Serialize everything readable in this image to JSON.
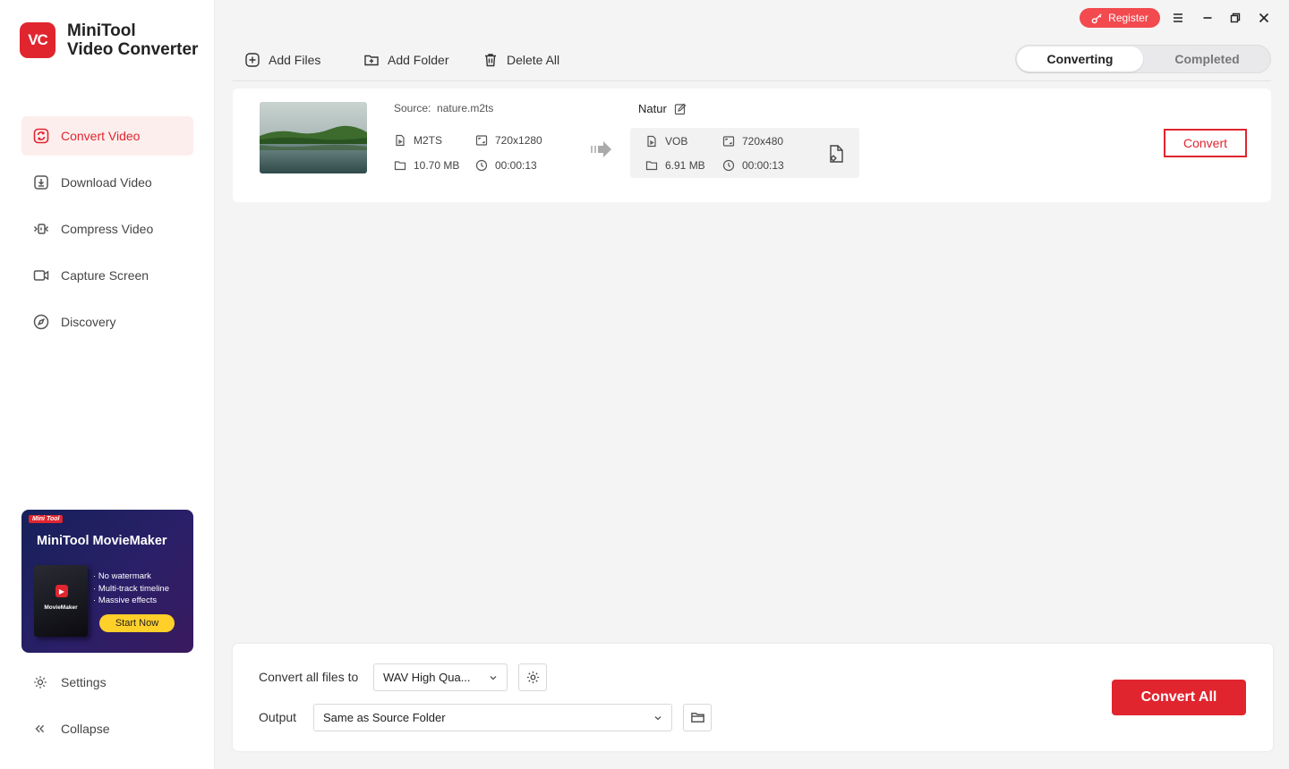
{
  "app": {
    "logo_text": "VC",
    "name_line1": "MiniTool",
    "name_line2": "Video Converter"
  },
  "sidebar": {
    "items": [
      {
        "label": "Convert Video",
        "icon": "convert-icon",
        "active": true
      },
      {
        "label": "Download Video",
        "icon": "download-icon"
      },
      {
        "label": "Compress Video",
        "icon": "compress-icon"
      },
      {
        "label": "Capture Screen",
        "icon": "camera-icon"
      },
      {
        "label": "Discovery",
        "icon": "compass-icon"
      }
    ],
    "promo": {
      "badge": "Mini Tool",
      "title": "MiniTool MovieMaker",
      "box_label": "MovieMaker",
      "features": [
        "No watermark",
        "Multi-track timeline",
        "Massive effects"
      ],
      "button": "Start Now"
    },
    "settings_label": "Settings",
    "collapse_label": "Collapse"
  },
  "window": {
    "register_label": "Register"
  },
  "toolbar": {
    "add_files": "Add Files",
    "add_folder": "Add Folder",
    "delete_all": "Delete All",
    "tabs": {
      "converting": "Converting",
      "completed": "Completed"
    }
  },
  "file": {
    "source_label": "Source:",
    "source_name": "nature.m2ts",
    "source_format": "M2TS",
    "source_resolution": "720x1280",
    "source_size": "10.70 MB",
    "source_duration": "00:00:13",
    "target_name": "Natur",
    "target_format": "VOB",
    "target_resolution": "720x480",
    "target_size": "6.91 MB",
    "target_duration": "00:00:13",
    "convert_label": "Convert"
  },
  "bottom": {
    "convert_all_label": "Convert all files to",
    "format_value": "WAV High Qua...",
    "output_label": "Output",
    "output_value": "Same as Source Folder",
    "convert_all_button": "Convert All"
  },
  "colors": {
    "accent": "#e0252f",
    "register": "#f24a4f",
    "promo_button": "#ffcf2a"
  }
}
